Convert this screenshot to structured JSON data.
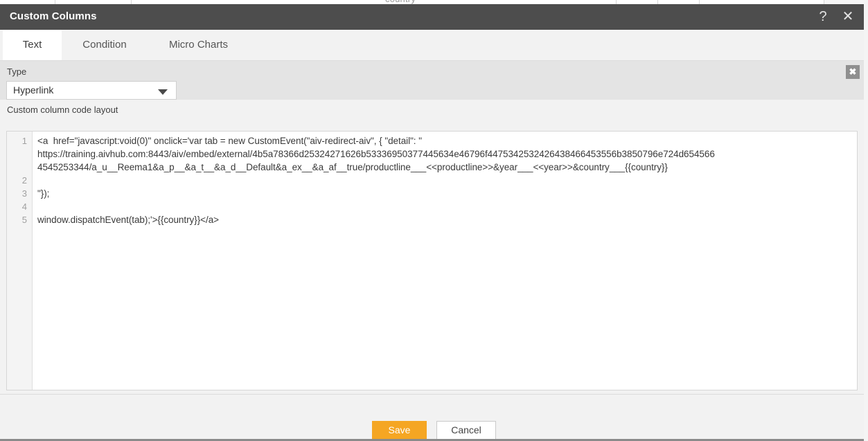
{
  "backdrop": {
    "label": "country",
    "caret_icon": "chevron-down-icon"
  },
  "dialog": {
    "title": "Custom Columns",
    "help_icon": "?",
    "close_icon": "✕",
    "tabs": [
      {
        "label": "Text",
        "active": true
      },
      {
        "label": "Condition",
        "active": false
      },
      {
        "label": "Micro Charts",
        "active": false
      }
    ],
    "type_section": {
      "label": "Type",
      "selected": "Hyperlink",
      "caret_icon": "triangle-down-icon",
      "clear_icon": "✖"
    },
    "code_section": {
      "label": "Custom column code layout",
      "line_numbers": [
        "1",
        "2",
        "3",
        "4",
        "5"
      ],
      "rows": [
        "<a  href=\"javascript:void(0)\" onclick='var tab = new CustomEvent(\"aiv-redirect-aiv\", { \"detail\": \"",
        "https://training.aivhub.com:8443/aiv/embed/external/4b5a78366d25324271626b53336950377445634e46796f4475342532426438466453556b3850796e724d654566",
        "4545253344/a_u__Reema1&a_p__&a_t__&a_d__Default&a_ex__&a_af__true/productline___<<productline>>&year___<<year>>&country___{{country}}",
        "\"});",
        "window.dispatchEvent(tab);'>{{country}}</a>"
      ]
    },
    "footer": {
      "save_label": "Save",
      "cancel_label": "Cancel"
    }
  },
  "colors": {
    "titlebar": "#4d4d4d",
    "accent": "#f5a623",
    "panel": "#f2f2f2",
    "type_panel": "#e4e4e4"
  }
}
